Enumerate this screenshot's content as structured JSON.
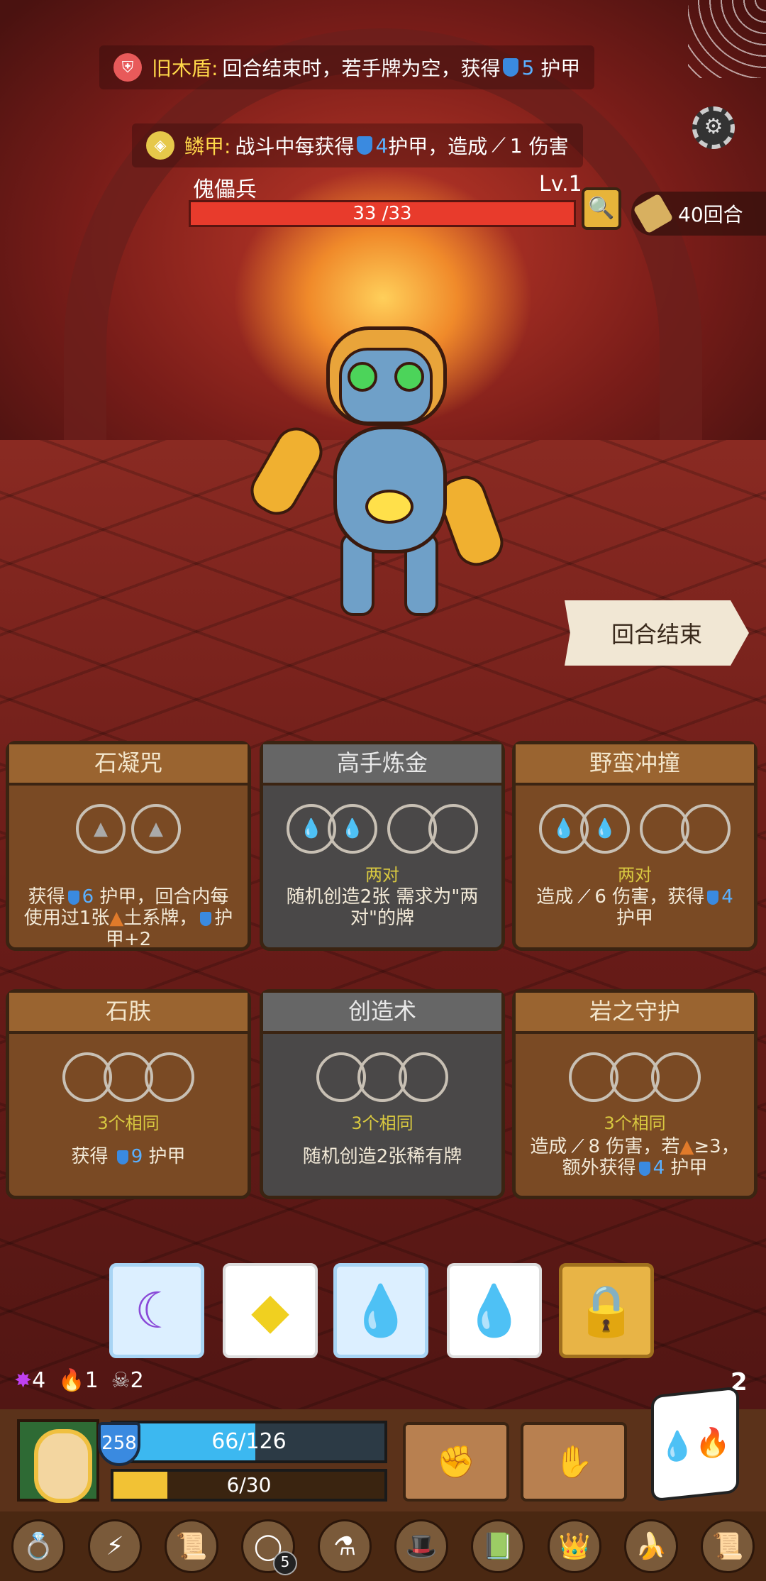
{
  "buffs": [
    {
      "name": "旧木盾:",
      "text_a": "回合结束时，若手牌为空，获得",
      "value": "5",
      "text_b": "护甲"
    },
    {
      "name": "鳞甲:",
      "text_a": "战斗中每获得",
      "value": "4",
      "text_b": "护甲，造成",
      "value2": "1",
      "text_c": "伤害"
    }
  ],
  "enemy": {
    "name": "傀儡兵",
    "level": "Lv.1",
    "hp_text": "33 /33",
    "hp_fraction": 1.0
  },
  "turns": "40回合",
  "end_turn_label": "回合结束",
  "cards": [
    {
      "title": "石凝咒",
      "req": "",
      "desc_a": "获得",
      "v": "6",
      "desc_b": "护甲，回合内每使用过1张",
      "desc_c": "土系牌，",
      "desc_d": "护甲+2"
    },
    {
      "title": "高手炼金",
      "req": "两对",
      "desc": "随机创造2张 需求为\"两对\"的牌"
    },
    {
      "title": "野蛮冲撞",
      "req": "两对",
      "desc_a": "造成",
      "v": "6",
      "desc_b": "伤害，获得",
      "v2": "4",
      "desc_c": "护甲"
    },
    {
      "title": "石肤",
      "req": "3个相同",
      "desc_a": "获得",
      "v": "9",
      "desc_b": "护甲"
    },
    {
      "title": "创造术",
      "req": "3个相同",
      "desc": "随机创造2张稀有牌"
    },
    {
      "title": "岩之守护",
      "req": "3个相同",
      "desc_a": "造成",
      "v": "8",
      "desc_b": "伤害，若",
      "desc_c": "≥3，",
      "desc_d": "额外获得",
      "v2": "4",
      "desc_e": "护甲"
    }
  ],
  "dice": [
    "moon",
    "diamond",
    "drop",
    "drop",
    "lock"
  ],
  "stats": {
    "poison": "4",
    "fire": "1",
    "skull": "2"
  },
  "roll_count": "2",
  "player": {
    "armor": "258",
    "hp_text": "66/126",
    "hp_fraction": 0.524,
    "xp_text": "6/30",
    "xp_fraction": 0.2
  },
  "relic_count": "5",
  "icons": {
    "gear": "⚙",
    "inspect": "🔍"
  }
}
